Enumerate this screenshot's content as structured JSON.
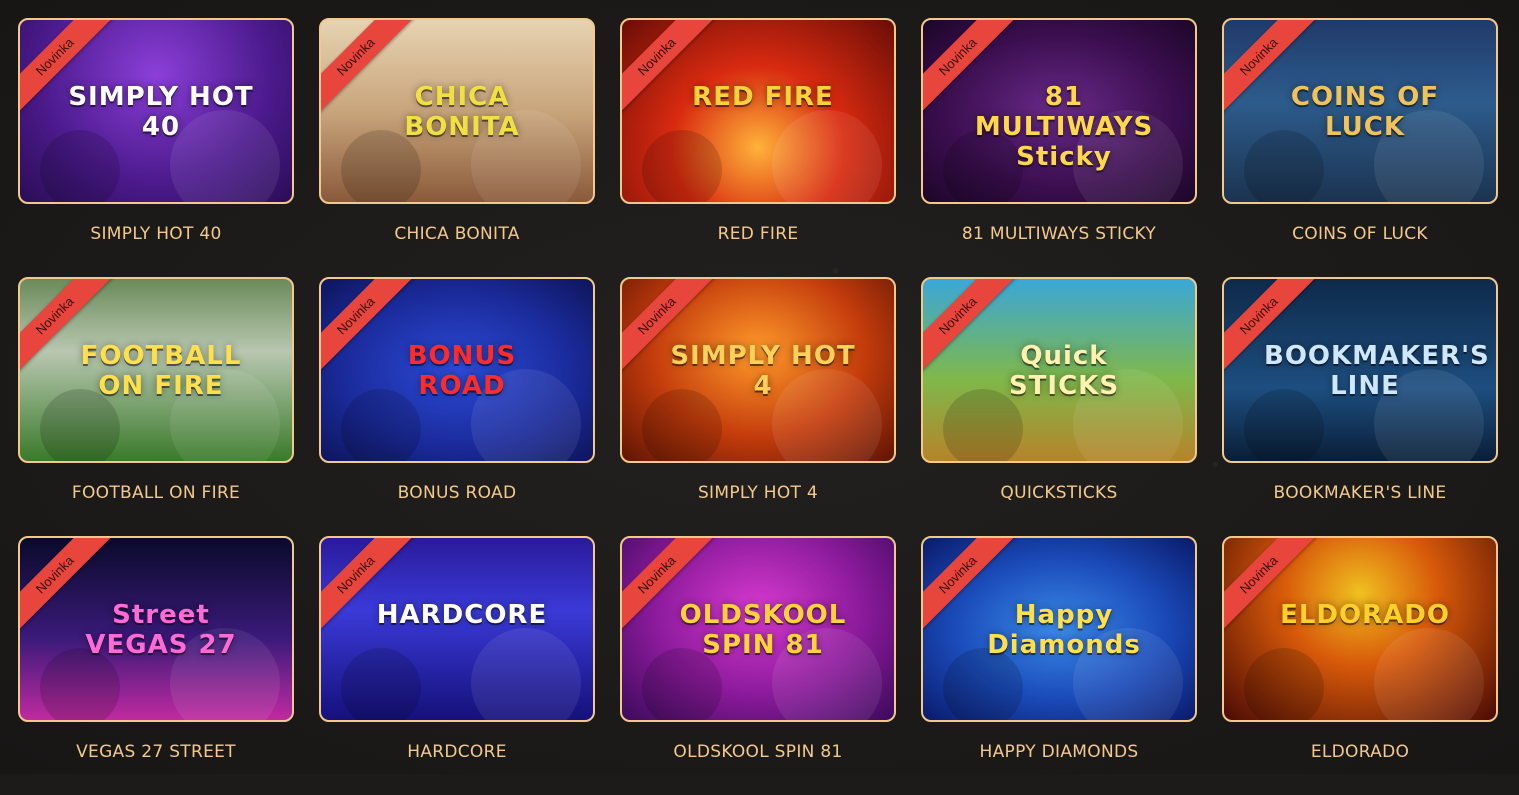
{
  "badge_label": "Novinka",
  "games": [
    {
      "name": "SIMPLY HOT 40",
      "art_text": "SIMPLY HOT 40",
      "art_color": "#ffffff"
    },
    {
      "name": "CHICA BONITA",
      "art_text": "CHICA BONITA",
      "art_color": "#f0e040"
    },
    {
      "name": "RED FIRE",
      "art_text": "RED FIRE",
      "art_color": "#ffd23a"
    },
    {
      "name": "81 MULTIWAYS STICKY",
      "art_text": "81 MULTIWAYS Sticky",
      "art_color": "#ffd84a"
    },
    {
      "name": "COINS OF LUCK",
      "art_text": "COINS OF LUCK",
      "art_color": "#f2c25a"
    },
    {
      "name": "FOOTBALL ON FIRE",
      "art_text": "FOOTBALL ON FIRE",
      "art_color": "#ffe04a"
    },
    {
      "name": "BONUS ROAD",
      "art_text": "BONUS ROAD",
      "art_color": "#ff2a2a"
    },
    {
      "name": "SIMPLY HOT 4",
      "art_text": "SIMPLY HOT 4",
      "art_color": "#ffd05a"
    },
    {
      "name": "QUICKSTICKS",
      "art_text": "Quick STICKS",
      "art_color": "#fff2b0"
    },
    {
      "name": "BOOKMAKER'S LINE",
      "art_text": "BOOKMAKER'S LINE",
      "art_color": "#cfe6ff"
    },
    {
      "name": "VEGAS 27 STREET",
      "art_text": "Street VEGAS 27",
      "art_color": "#ff6ad8"
    },
    {
      "name": "HARDCORE",
      "art_text": "HARDCORE",
      "art_color": "#ffffff"
    },
    {
      "name": "OLDSKOOL SPIN 81",
      "art_text": "OLDSKOOL SPIN 81",
      "art_color": "#ffd23a"
    },
    {
      "name": "HAPPY DIAMONDS",
      "art_text": "Happy Diamonds",
      "art_color": "#ffe04a"
    },
    {
      "name": "ELDORADO",
      "art_text": "ELDORADO",
      "art_color": "#ffd02a"
    }
  ]
}
